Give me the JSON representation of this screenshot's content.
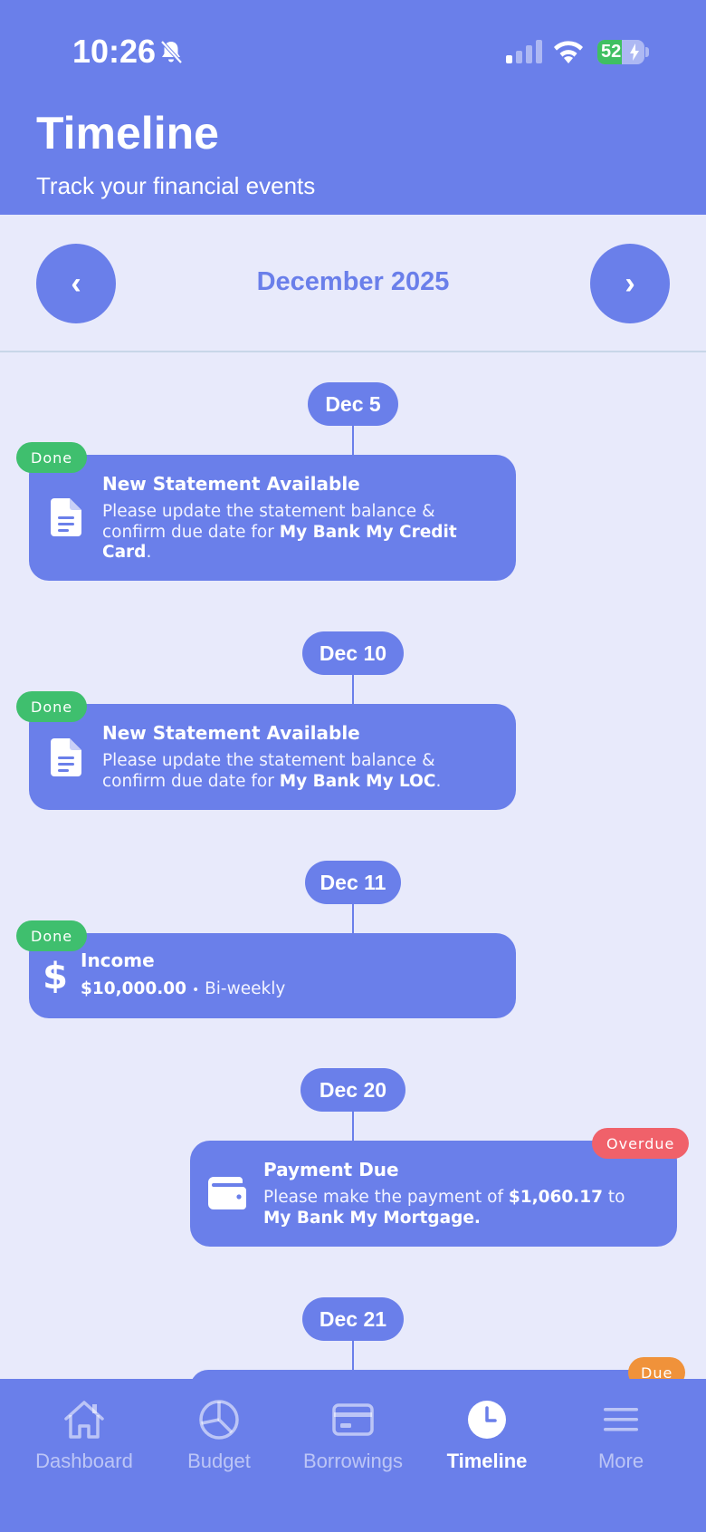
{
  "status_bar": {
    "time": "10:26",
    "battery": "52",
    "battery_level": 0.52
  },
  "header": {
    "title": "Timeline",
    "subtitle": "Track your financial events"
  },
  "month_nav": {
    "prev_label": "‹",
    "month": "December 2025",
    "next_label": "›"
  },
  "events": [
    {
      "date": "Dec 5",
      "status": "Done",
      "icon": "document-icon",
      "title": "New Statement Available",
      "body_prefix": "Please update the statement balance & confirm due date for ",
      "body_bold": "My Bank My Credit Card",
      "body_suffix": "."
    },
    {
      "date": "Dec 10",
      "status": "Done",
      "icon": "document-icon",
      "title": "New Statement Available",
      "body_prefix": "Please update the statement balance & confirm due date for ",
      "body_bold": "My Bank My LOC",
      "body_suffix": "."
    },
    {
      "date": "Dec 11",
      "status": "Done",
      "icon": "dollar-icon",
      "title": "Income",
      "amount": "$10,000.00",
      "separator": "•",
      "frequency": "Bi-weekly"
    },
    {
      "date": "Dec 20",
      "status": "Overdue",
      "icon": "wallet-icon",
      "title": "Payment Due",
      "body_prefix": "Please make the payment of ",
      "amount": "$1,060.17",
      "body_mid": " to ",
      "body_bold": "My Bank My Mortgage."
    },
    {
      "date": "Dec 21",
      "status": "Due"
    }
  ],
  "tabs": [
    {
      "label": "Dashboard",
      "icon": "home-icon",
      "active": false
    },
    {
      "label": "Budget",
      "icon": "pie-chart-icon",
      "active": false
    },
    {
      "label": "Borrowings",
      "icon": "credit-card-icon",
      "active": false
    },
    {
      "label": "Timeline",
      "icon": "clock-icon",
      "active": true
    },
    {
      "label": "More",
      "icon": "menu-icon",
      "active": false
    }
  ],
  "colors": {
    "primary": "#6a7fea",
    "background": "#e8eafb",
    "done": "#3fbf6e",
    "overdue": "#f0616a",
    "due": "#f0923a"
  }
}
